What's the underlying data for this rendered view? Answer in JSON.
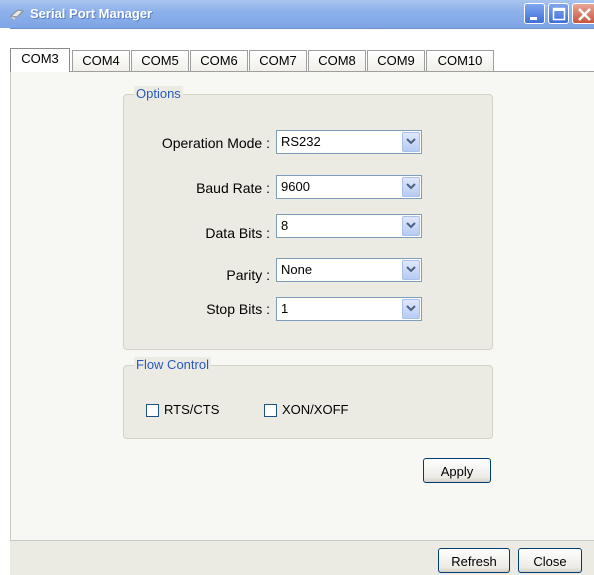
{
  "window": {
    "title": "Serial Port Manager",
    "colors": {
      "titlebar": "#8db1ea",
      "accent": "#2a58c0"
    }
  },
  "tabs": [
    {
      "label": "COM3",
      "active": true
    },
    {
      "label": "COM4",
      "active": false
    },
    {
      "label": "COM5",
      "active": false
    },
    {
      "label": "COM6",
      "active": false
    },
    {
      "label": "COM7",
      "active": false
    },
    {
      "label": "COM8",
      "active": false
    },
    {
      "label": "COM9",
      "active": false
    },
    {
      "label": "COM10",
      "active": false
    }
  ],
  "options": {
    "title": "Options",
    "operation_mode": {
      "label": "Operation Mode :",
      "value": "RS232"
    },
    "baud_rate": {
      "label": "Baud Rate :",
      "value": "9600"
    },
    "data_bits": {
      "label": "Data Bits :",
      "value": "8"
    },
    "parity": {
      "label": "Parity :",
      "value": "None"
    },
    "stop_bits": {
      "label": "Stop Bits :",
      "value": "1"
    }
  },
  "flow_control": {
    "title": "Flow Control",
    "rts_cts": {
      "label": "RTS/CTS",
      "checked": false
    },
    "xon_xoff": {
      "label": "XON/XOFF",
      "checked": false
    }
  },
  "buttons": {
    "apply": "Apply",
    "refresh": "Refresh",
    "close": "Close"
  },
  "icons": {
    "title_icon": "serial-port-icon",
    "minimize": "minimize-icon",
    "maximize": "maximize-icon",
    "close": "close-icon",
    "dropdown": "chevron-down-icon"
  }
}
